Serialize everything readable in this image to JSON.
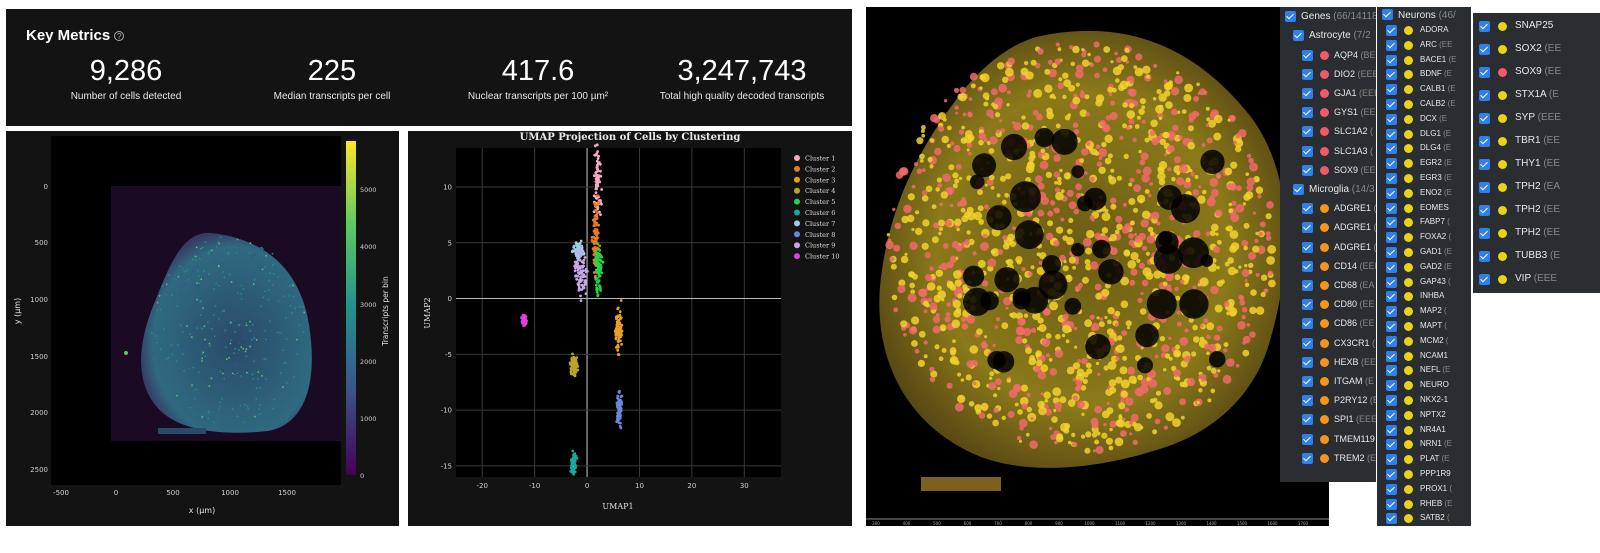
{
  "key_metrics": {
    "title": "Key Metrics",
    "help_glyph": "?",
    "items": [
      {
        "value": "9,286",
        "label": "Number of cells detected"
      },
      {
        "value": "225",
        "label": "Median transcripts per cell"
      },
      {
        "value": "417.6",
        "label": "Nuclear transcripts per 100 µm²"
      },
      {
        "value": "3,247,743",
        "label": "Total high quality decoded transcripts"
      }
    ]
  },
  "heatmap": {
    "xlabel": "x (µm)",
    "ylabel": "y (µm)",
    "colorbar_label": "Transcripts per bin",
    "x_ticks": [
      "-500",
      "0",
      "500",
      "1000",
      "1500"
    ],
    "y_ticks": [
      "0",
      "500",
      "1000",
      "1500",
      "2000",
      "2500"
    ],
    "colorbar_ticks": [
      "0",
      "1000",
      "2000",
      "3000",
      "4000",
      "5000"
    ]
  },
  "chart_data": {
    "type": "scatter",
    "title": "UMAP Projection of Cells by Clustering",
    "xlabel": "UMAP1",
    "ylabel": "UMAP2",
    "xlim": [
      -25,
      37
    ],
    "ylim": [
      -16,
      13.5
    ],
    "x_ticks": [
      "-20",
      "-10",
      "0",
      "10",
      "20",
      "30"
    ],
    "y_ticks": [
      "10",
      "5",
      "0",
      "-5",
      "-10",
      "-15"
    ],
    "grid": true,
    "legend_position": "top-right",
    "series": [
      {
        "name": "Cluster 1",
        "color": "#f7a8c4",
        "cx": 2.0,
        "cy": 10.0,
        "sx": 0.4,
        "sy": 2.0
      },
      {
        "name": "Cluster 2",
        "color": "#ea7a1e",
        "cx": 1.6,
        "cy": 5.8,
        "sx": 0.4,
        "sy": 2.2
      },
      {
        "name": "Cluster 3",
        "color": "#e6a21f",
        "cx": 6.0,
        "cy": -2.8,
        "sx": 0.4,
        "sy": 1.2
      },
      {
        "name": "Cluster 4",
        "color": "#b8a32b",
        "cx": -2.5,
        "cy": -6.0,
        "sx": 0.4,
        "sy": 0.5
      },
      {
        "name": "Cluster 5",
        "color": "#25d24a",
        "cx": 2.2,
        "cy": 2.6,
        "sx": 0.4,
        "sy": 1.4
      },
      {
        "name": "Cluster 6",
        "color": "#1aa99d",
        "cx": -2.6,
        "cy": -14.8,
        "sx": 0.3,
        "sy": 0.6
      },
      {
        "name": "Cluster 7",
        "color": "#9ccde8",
        "cx": -1.5,
        "cy": 4.3,
        "sx": 0.6,
        "sy": 0.4
      },
      {
        "name": "Cluster 8",
        "color": "#6b87d9",
        "cx": 6.1,
        "cy": -10.0,
        "sx": 0.3,
        "sy": 0.9
      },
      {
        "name": "Cluster 9",
        "color": "#c7a6e8",
        "cx": -1.2,
        "cy": 2.3,
        "sx": 0.7,
        "sy": 1.2
      },
      {
        "name": "Cluster 10",
        "color": "#e13ee0",
        "cx": -12.0,
        "cy": -1.9,
        "sx": 0.25,
        "sy": 0.3
      }
    ]
  },
  "panel_genes": {
    "header": "Genes",
    "header_sub": "(66/14118)",
    "groups": [
      {
        "label": "Astrocyte",
        "sub": "(7/2"
      },
      {
        "label": "Microglia",
        "sub": "(14/3"
      }
    ],
    "rows": [
      {
        "type": "group",
        "g": 0
      },
      {
        "label": "AQP4",
        "sub": "(BE",
        "color": "#f25a6a"
      },
      {
        "label": "DIO2",
        "sub": "(EEE",
        "color": "#f25a6a"
      },
      {
        "label": "GJA1",
        "sub": "(EEE",
        "color": "#f25a6a"
      },
      {
        "label": "GYS1",
        "sub": "(EEE",
        "color": "#f25a6a"
      },
      {
        "label": "SLC1A2",
        "sub": "(",
        "color": "#f25a6a"
      },
      {
        "label": "SLC1A3",
        "sub": "(",
        "color": "#f25a6a"
      },
      {
        "label": "SOX9",
        "sub": "(EE",
        "color": "#f25a6a"
      },
      {
        "type": "group",
        "g": 1
      },
      {
        "label": "ADGRE1",
        "sub": "(",
        "color": "#f7941d"
      },
      {
        "label": "ADGRE1",
        "sub": "(",
        "color": "#f7941d"
      },
      {
        "label": "ADGRE1",
        "sub": "(",
        "color": "#f7941d"
      },
      {
        "label": "CD14",
        "sub": "(EEE",
        "color": "#f7941d"
      },
      {
        "label": "CD68",
        "sub": "(EA",
        "color": "#f7941d"
      },
      {
        "label": "CD80",
        "sub": "(EE",
        "color": "#f7941d"
      },
      {
        "label": "CD86",
        "sub": "(EE",
        "color": "#f7941d"
      },
      {
        "label": "CX3CR1",
        "sub": "(",
        "color": "#f7941d"
      },
      {
        "label": "HEXB",
        "sub": "(EE",
        "color": "#f7941d"
      },
      {
        "label": "ITGAM",
        "sub": "(E",
        "color": "#f7941d"
      },
      {
        "label": "P2RY12",
        "sub": "(E",
        "color": "#f7941d"
      },
      {
        "label": "SPI1",
        "sub": "(EEE",
        "color": "#f7941d"
      },
      {
        "label": "TMEM119",
        "sub": "",
        "color": "#f7941d"
      },
      {
        "label": "TREM2",
        "sub": "(E",
        "color": "#f7941d"
      }
    ]
  },
  "panel_neurons": {
    "header": "Neurons",
    "header_sub": "(46/",
    "rows": [
      "ADORA",
      "ARC",
      "BACE1",
      "BDNF",
      "CALB1",
      "CALB2",
      "DCX",
      "DLG1",
      "DLG4",
      "EGR2",
      "EGR3",
      "ENO2",
      "EOMES",
      "FABP7",
      "FOXA2",
      "GAD1",
      "GAD2",
      "GAP43",
      "INHBA",
      "MAP2",
      "MAPT",
      "MCM2",
      "NCAM1",
      "NEFL",
      "NEURO",
      "NKX2-1",
      "NPTX2",
      "NR4A1",
      "NRN1",
      "PLAT",
      "PPP1R9",
      "PROX1",
      "RHEB",
      "SATB2"
    ],
    "row_subs": [
      "",
      "(EE",
      "(E",
      "(E",
      "(E",
      "(E",
      "(E",
      "(E",
      "(E",
      "(E",
      "(E",
      "(E",
      "",
      "(",
      "(",
      "(E",
      "(E",
      "(",
      "",
      "(",
      "(",
      "(",
      "",
      "(E",
      "",
      "",
      "",
      "",
      "(E",
      "(E",
      "",
      "(",
      "(E",
      "("
    ],
    "color": "#e8d21a"
  },
  "panel_more": {
    "rows": [
      {
        "label": "SNAP25",
        "sub": "",
        "color": "#e8d21a"
      },
      {
        "label": "SOX2",
        "sub": "(EE",
        "color": "#e8d21a"
      },
      {
        "label": "SOX9",
        "sub": "(EE",
        "color": "#f25a6a"
      },
      {
        "label": "STX1A",
        "sub": "(E",
        "color": "#e8d21a"
      },
      {
        "label": "SYP",
        "sub": "(EEE",
        "color": "#e8d21a"
      },
      {
        "label": "TBR1",
        "sub": "(EE",
        "color": "#e8d21a"
      },
      {
        "label": "THY1",
        "sub": "(EE",
        "color": "#e8d21a"
      },
      {
        "label": "TPH2",
        "sub": "(EA",
        "color": "#e8d21a"
      },
      {
        "label": "TPH2",
        "sub": "(EE",
        "color": "#e8d21a"
      },
      {
        "label": "TPH2",
        "sub": "(EE",
        "color": "#e8d21a"
      },
      {
        "label": "TUBB3",
        "sub": "(E",
        "color": "#e8d21a"
      },
      {
        "label": "VIP",
        "sub": "(EEE",
        "color": "#e8d21a"
      }
    ]
  },
  "scale_ticks": [
    "300",
    "400",
    "500",
    "600",
    "700",
    "800",
    "900",
    "1000",
    "1100",
    "1200",
    "1300",
    "1400",
    "1500",
    "1600",
    "1700"
  ]
}
